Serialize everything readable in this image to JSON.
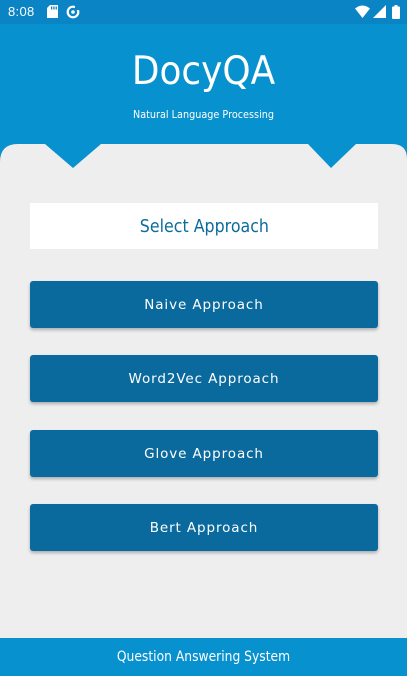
{
  "status_bar": {
    "time": "8:08",
    "icons": [
      "sd-card-icon",
      "data-saver-icon",
      "wifi-icon",
      "signal-icon",
      "battery-icon"
    ],
    "background": "#0a84c4"
  },
  "header": {
    "title": "DocyQA",
    "subtitle": "Natural Language Processing",
    "background": "#0891cf"
  },
  "select": {
    "label": "Select Approach",
    "text_color": "#0b6c9c"
  },
  "buttons": [
    {
      "label": "Naive Approach"
    },
    {
      "label": "Word2Vec Approach"
    },
    {
      "label": "Glove Approach"
    },
    {
      "label": "Bert Approach"
    }
  ],
  "button_color": "#0a6a9e",
  "footer": {
    "label": "Question Answering System",
    "background": "#0891cf"
  }
}
